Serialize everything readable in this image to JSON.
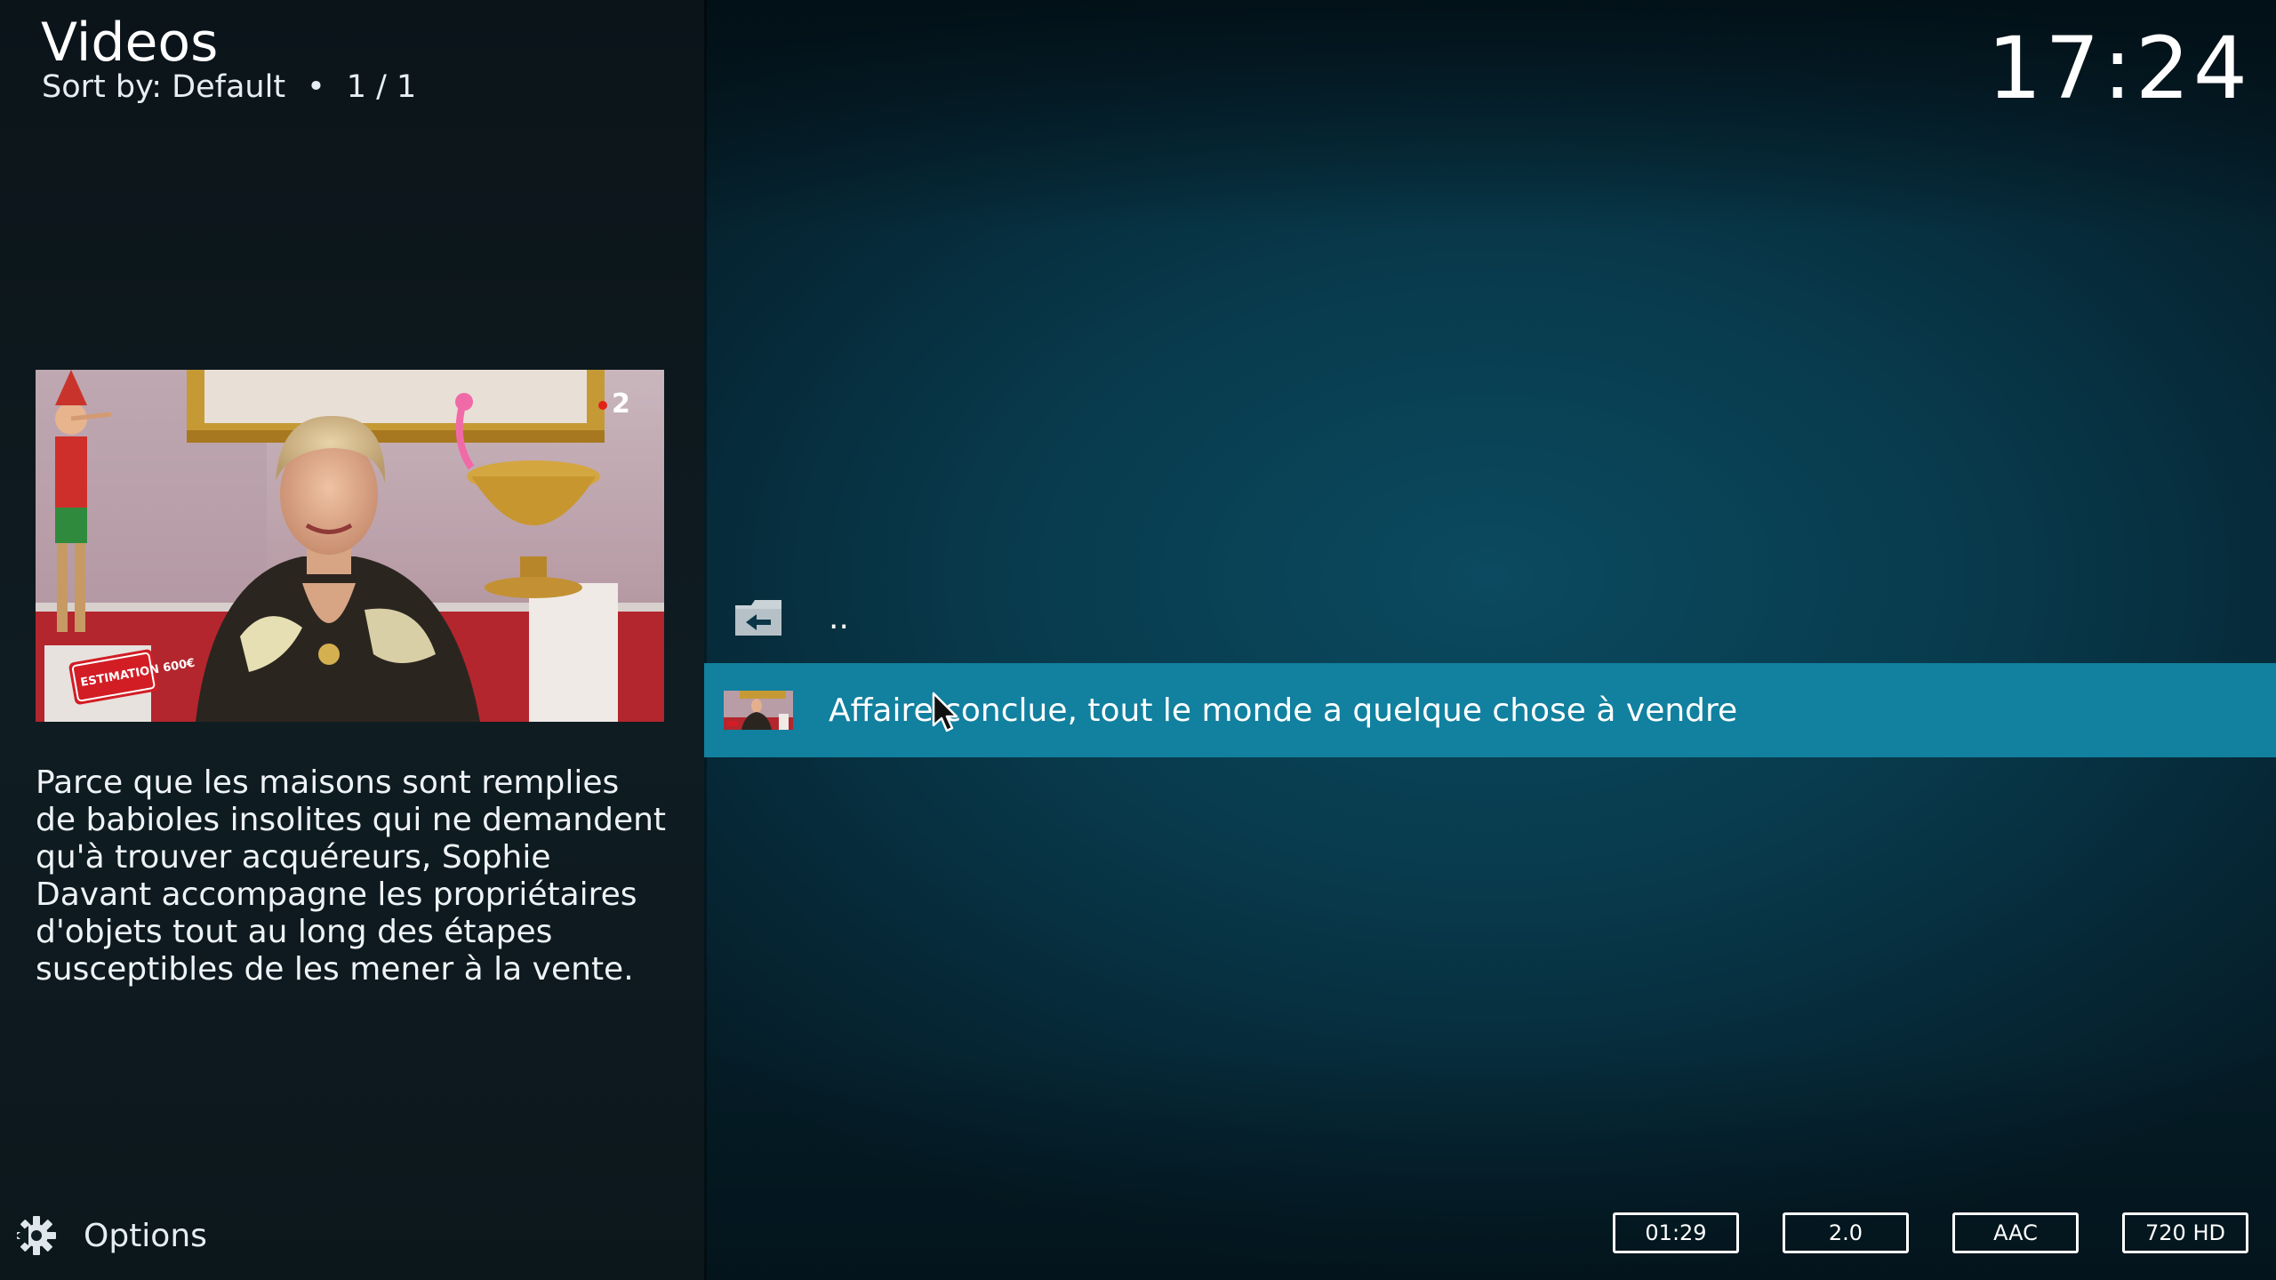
{
  "header": {
    "title": "Videos",
    "sort_label": "Sort by: Default",
    "separator": "•",
    "page_counter": "1 / 1",
    "clock": "17:24"
  },
  "info_panel": {
    "thumbnail_icon": "tv-show-thumbnail",
    "channel_badge": "2",
    "estimation_sticker": "ESTIMATION 600€",
    "plot": "Parce que les maisons sont remplies de babioles insolites qui ne demandent qu'à trouver acquéreurs, Sophie Davant accompagne les propriétaires d'objets tout au long des étapes susceptibles de les mener à la vente."
  },
  "list": {
    "items": [
      {
        "label": "..",
        "icon": "folder-back-icon"
      },
      {
        "label": "Affaire conclue, tout le monde a quelque chose à vendre",
        "icon": "video-thumbnail-icon",
        "selected": true
      }
    ]
  },
  "footer": {
    "options_label": "Options",
    "badges": {
      "duration": "01:29",
      "audio_channels": "2.0",
      "audio_codec": "AAC",
      "resolution": "720 HD"
    }
  },
  "colors": {
    "accent": "#12809f",
    "background_right": "#083a4c",
    "background_left": "#0f1c22"
  }
}
